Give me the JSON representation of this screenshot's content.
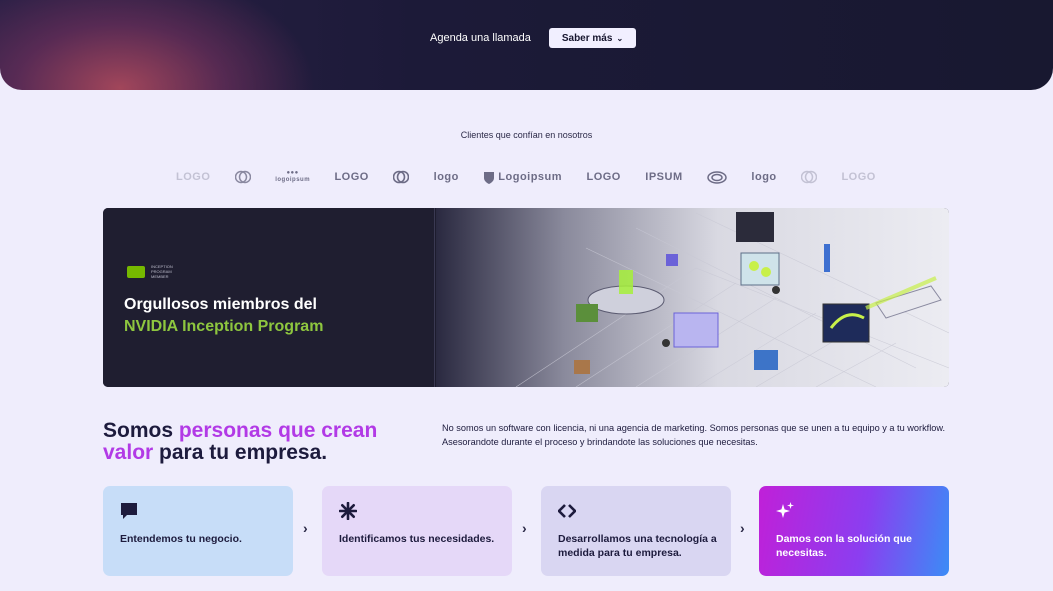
{
  "hero": {
    "call_link": "Agenda una llamada",
    "more_button": "Saber más",
    "more_icon": "chevron-down-icon"
  },
  "clients": {
    "title": "Clientes que confían en nosotros",
    "logos": [
      "LOGO",
      "logo-ring",
      "logoipsum",
      "LOGO",
      "logo-ring",
      "logo",
      "Logoipsum",
      "LOGO",
      "IPSUM",
      "logo-oval",
      "logo",
      "logo-ring",
      "LOGO"
    ]
  },
  "banner": {
    "badge_line1": "INCEPTION",
    "badge_line2": "PROGRAM",
    "badge_line3": "MEMBER",
    "title_line1": "Orgullosos miembros del",
    "title_line2": "NVIDIA Inception Program",
    "accent_color": "#8ec63f"
  },
  "intro": {
    "h_part1": "Somos ",
    "h_highlight1": "personas que crean",
    "h_highlight2": "valor",
    "h_part2": " para tu empresa.",
    "paragraph": "No somos un software con licencia, ni una agencia de marketing. Somos personas que se unen a tu equipo y a tu workflow. Asesorandote durante el proceso y brindandote las soluciones que necesitas.",
    "highlight_color": "#b23ae6"
  },
  "steps": [
    {
      "icon": "chat-bubble-icon",
      "label": "Entendemos tu negocio."
    },
    {
      "icon": "asterisk-icon",
      "label": "Identificamos tus necesidades."
    },
    {
      "icon": "code-diamond-icon",
      "label": "Desarrollamos una tecnología a medida para tu empresa."
    },
    {
      "icon": "sparkle-icon",
      "label": "Damos con la solución que necesitas."
    }
  ],
  "step_separator": "›"
}
